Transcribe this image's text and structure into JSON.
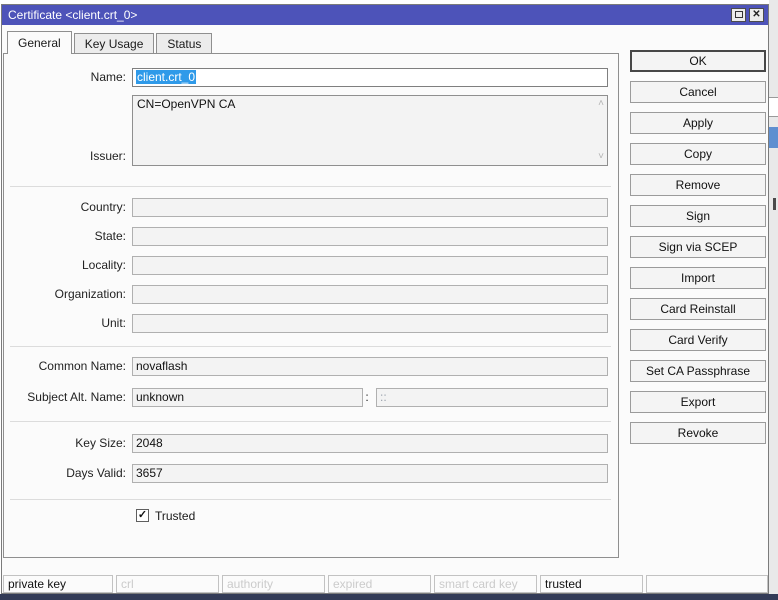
{
  "window": {
    "title": "Certificate <client.crt_0>"
  },
  "tabs": [
    {
      "label": "General"
    },
    {
      "label": "Key Usage"
    },
    {
      "label": "Status"
    }
  ],
  "form": {
    "name": {
      "label": "Name:",
      "value": "client.crt_0"
    },
    "issuer": {
      "label": "Issuer:",
      "value": "CN=OpenVPN CA"
    },
    "country": {
      "label": "Country:",
      "value": ""
    },
    "state": {
      "label": "State:",
      "value": ""
    },
    "locality": {
      "label": "Locality:",
      "value": ""
    },
    "organization": {
      "label": "Organization:",
      "value": ""
    },
    "unit": {
      "label": "Unit:",
      "value": ""
    },
    "common_name": {
      "label": "Common Name:",
      "value": "novaflash"
    },
    "subject_alt_name": {
      "label": "Subject Alt. Name:",
      "value": "unknown",
      "separator": ":",
      "value2": "::"
    },
    "key_size": {
      "label": "Key Size:",
      "value": "2048"
    },
    "days_valid": {
      "label": "Days Valid:",
      "value": "3657"
    },
    "trusted": {
      "label": "Trusted",
      "checked": true
    }
  },
  "icons": {
    "check": "✓",
    "close": "✕",
    "scroll_up": "˄",
    "scroll_down": "˅"
  },
  "buttons": [
    "OK",
    "Cancel",
    "Apply",
    "Copy",
    "Remove",
    "Sign",
    "Sign via SCEP",
    "Import",
    "Card Reinstall",
    "Card Verify",
    "Set CA Passphrase",
    "Export",
    "Revoke"
  ],
  "status_flags": [
    {
      "label": "private key",
      "enabled": true
    },
    {
      "label": "crl",
      "enabled": false
    },
    {
      "label": "authority",
      "enabled": false
    },
    {
      "label": "expired",
      "enabled": false
    },
    {
      "label": "smart card key",
      "enabled": false
    },
    {
      "label": "trusted",
      "enabled": true
    },
    {
      "label": "",
      "enabled": false
    }
  ],
  "colors": {
    "titlebar": "#4d53b9",
    "selection": "#2f9ae9",
    "status_disabled_text": "#cbcbcb",
    "background_selection_row": "#5f8fd0"
  }
}
